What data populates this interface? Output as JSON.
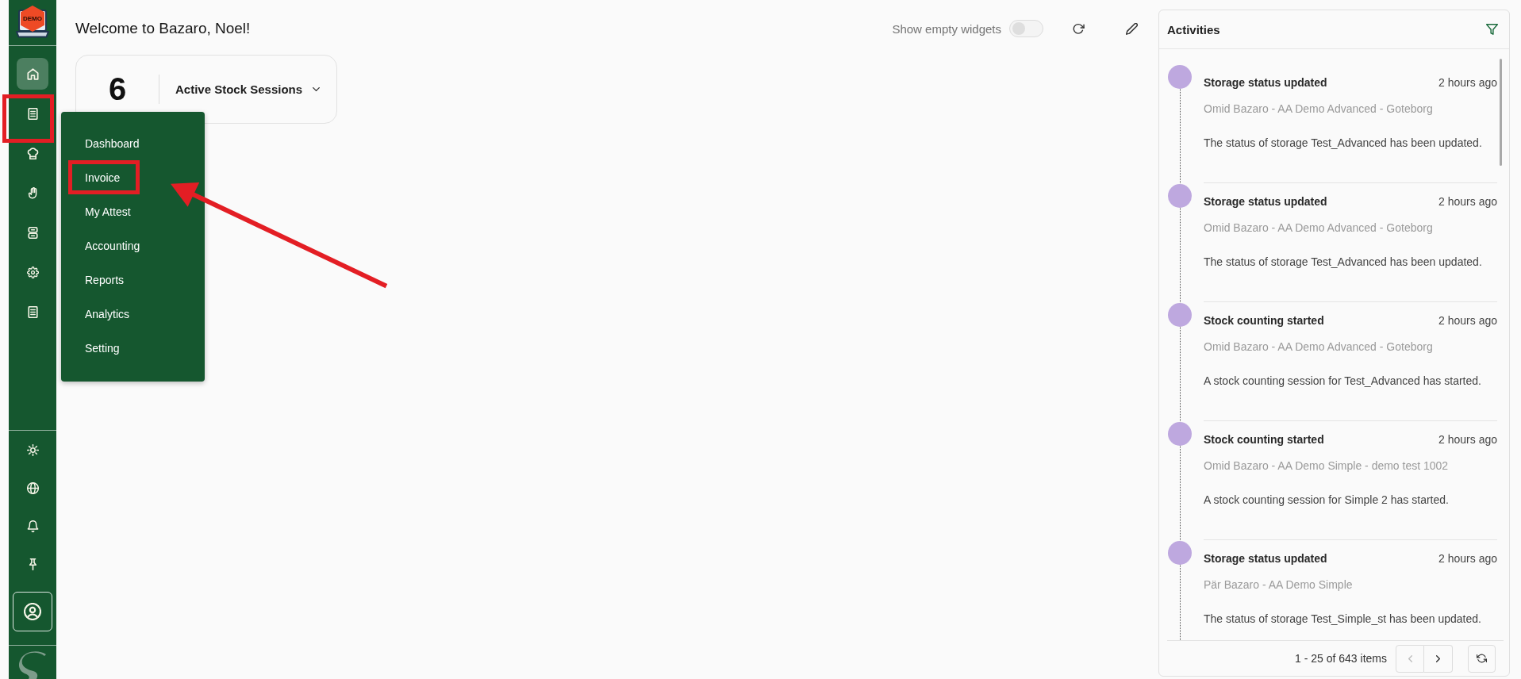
{
  "sidebar": {
    "logo_badge": "DEMO",
    "nav_items": [
      {
        "selected": true,
        "highlighted": false
      },
      {
        "selected": false,
        "highlighted": true
      },
      {
        "selected": false,
        "highlighted": false
      },
      {
        "selected": false,
        "highlighted": false
      },
      {
        "selected": false,
        "highlighted": false
      },
      {
        "selected": false,
        "highlighted": false
      },
      {
        "selected": false,
        "highlighted": false
      }
    ]
  },
  "header": {
    "title": "Welcome to Bazaro, Noel!"
  },
  "toolbar": {
    "toggle": {
      "label": "Show empty widgets",
      "on": false
    }
  },
  "widget": {
    "value": "6",
    "label": "Active Stock Sessions"
  },
  "flyout_menu": {
    "items": [
      {
        "label": "Dashboard",
        "highlighted": false
      },
      {
        "label": "Invoice",
        "highlighted": true
      },
      {
        "label": "My Attest",
        "highlighted": false
      },
      {
        "label": "Accounting",
        "highlighted": false
      },
      {
        "label": "Reports",
        "highlighted": false
      },
      {
        "label": "Analytics",
        "highlighted": false
      },
      {
        "label": "Setting",
        "highlighted": false
      }
    ]
  },
  "annotations": [
    {
      "kind": "arrow"
    }
  ],
  "activities": {
    "title": "Activities",
    "items": [
      {
        "title": "Storage status updated",
        "time": "2 hours ago",
        "source": "Omid Bazaro - AA Demo Advanced - Goteborg",
        "message": "The status of storage Test_Advanced has been updated."
      },
      {
        "title": "Storage status updated",
        "time": "2 hours ago",
        "source": "Omid Bazaro - AA Demo Advanced - Goteborg",
        "message": "The status of storage Test_Advanced has been updated."
      },
      {
        "title": "Stock counting started",
        "time": "2 hours ago",
        "source": "Omid Bazaro - AA Demo Advanced - Goteborg",
        "message": "A stock counting session for Test_Advanced has started."
      },
      {
        "title": "Stock counting started",
        "time": "2 hours ago",
        "source": "Omid Bazaro - AA Demo Simple - demo test 1002",
        "message": "A stock counting session for Simple 2 has started."
      },
      {
        "title": "Storage status updated",
        "time": "2 hours ago",
        "source": "Pär Bazaro - AA Demo Simple",
        "message": "The status of storage Test_Simple_st has been updated."
      }
    ],
    "pagination": {
      "summary": "1 - 25 of 643 items",
      "prev": {
        "disabled": true
      },
      "next": {
        "disabled": false
      }
    }
  }
}
